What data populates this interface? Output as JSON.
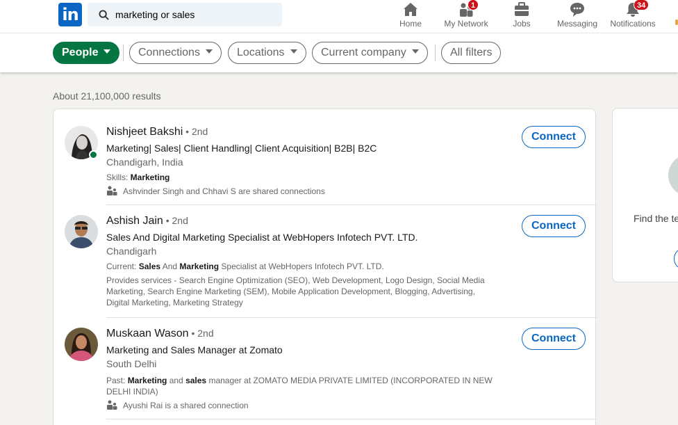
{
  "nav": {
    "logo_text": "in",
    "search_value": "marketing or sales",
    "items": [
      {
        "label": "Home",
        "icon": "home-icon"
      },
      {
        "label": "My Network",
        "icon": "network-icon",
        "badge": "1"
      },
      {
        "label": "Jobs",
        "icon": "jobs-icon"
      },
      {
        "label": "Messaging",
        "icon": "messaging-icon"
      },
      {
        "label": "Notifications",
        "icon": "bell-icon",
        "badge": "34"
      }
    ]
  },
  "filters": {
    "people": "People",
    "connections": "Connections",
    "locations": "Locations",
    "current_company": "Current company",
    "all_filters": "All filters",
    "accent": "#057642"
  },
  "results_count": "About 21,100,000 results",
  "results": [
    {
      "name": "Nishjeet Bakshi",
      "degree": " • 2nd",
      "headline": "Marketing| Sales| Client Handling| Client Acquisition| B2B| B2C",
      "location": "Chandigarh, India",
      "skills_label": "Skills: ",
      "skills_value": "Marketing",
      "shared": "Ashvinder Singh and Chhavi S are shared connections",
      "connect": "Connect"
    },
    {
      "name": "Ashish Jain",
      "degree": " • 2nd",
      "headline": "Sales And Digital Marketing Specialist at WebHopers Infotech PVT. LTD.",
      "location": "Chandigarh",
      "current_label": "Current: ",
      "current_b1": "Sales",
      "current_mid": " And ",
      "current_b2": "Marketing",
      "current_rest": " Specialist at WebHopers Infotech PVT. LTD.",
      "services": "Provides services - Search Engine Optimization (SEO), Web Development, Logo Design, Social Media Marketing, Search Engine Marketing (SEM), Mobile Application Development, Blogging, Advertising, Digital Marketing, Marketing Strategy",
      "connect": "Connect"
    },
    {
      "name": "Muskaan Wason",
      "degree": " • 2nd",
      "headline": "Marketing and Sales Manager at Zomato",
      "location": "South Delhi",
      "past_label": "Past: ",
      "past_b1": "Marketing",
      "past_mid": " and ",
      "past_b2": "sales",
      "past_rest": " manager at ZOMATO MEDIA PRIVATE LIMITED (INCORPORATED IN NEW DELHI INDIA)",
      "shared": "Ayushi Rai is a shared connection",
      "connect": "Connect"
    }
  ],
  "side": {
    "text": "Find the te"
  }
}
